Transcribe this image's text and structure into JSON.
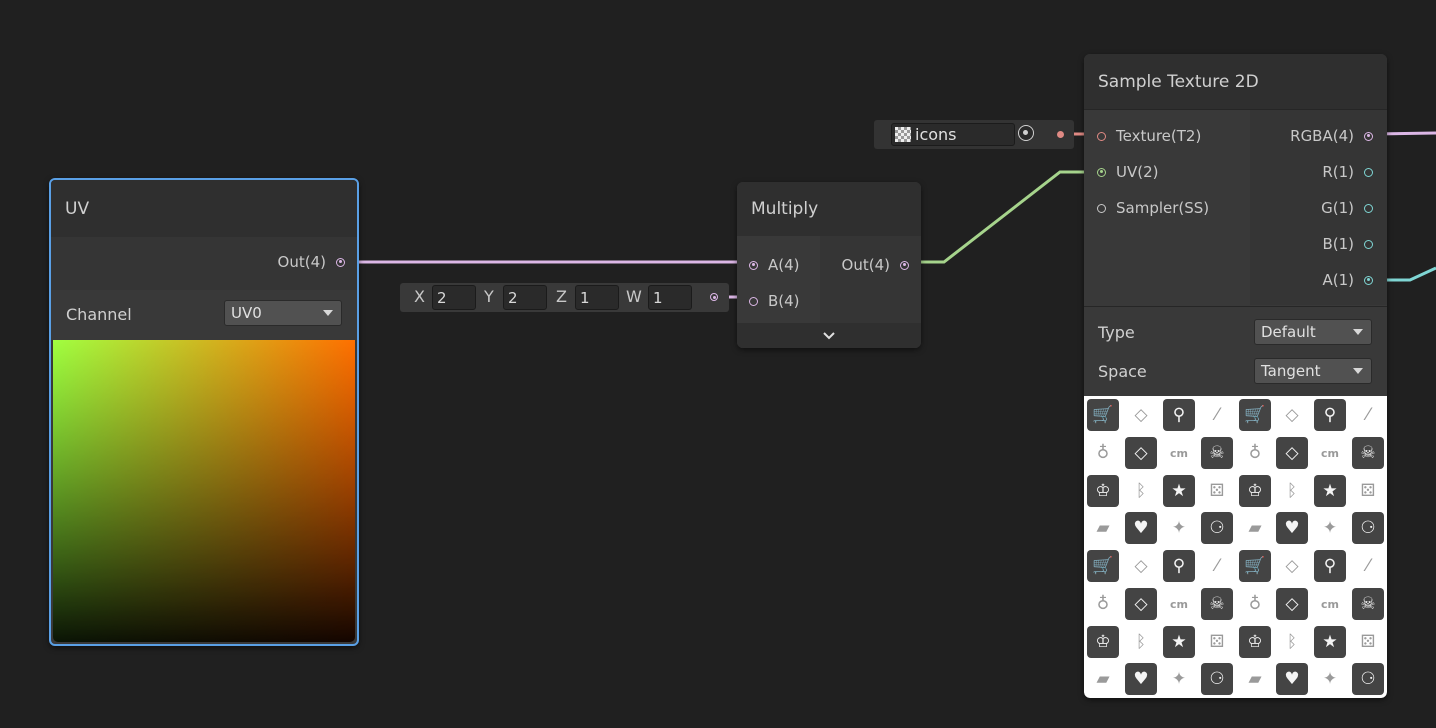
{
  "colors": {
    "background": "#202020",
    "selection": "#5aa0e6",
    "vector4": "#dcb7e6",
    "vector2": "#a6d48c",
    "texture": "#e08a84",
    "vector1": "#7fd6d4"
  },
  "uv_node": {
    "title": "UV",
    "out_label": "Out(4)",
    "channel_label": "Channel",
    "channel_value": "UV0"
  },
  "vector_input": {
    "fields": [
      {
        "axis": "X",
        "value": "2"
      },
      {
        "axis": "Y",
        "value": "2"
      },
      {
        "axis": "Z",
        "value": "1"
      },
      {
        "axis": "W",
        "value": "1"
      }
    ]
  },
  "multiply_node": {
    "title": "Multiply",
    "input_a": "A(4)",
    "input_b": "B(4)",
    "output": "Out(4)"
  },
  "texture_property": {
    "name": "icons"
  },
  "sample_node": {
    "title": "Sample Texture 2D",
    "inputs": [
      "Texture(T2)",
      "UV(2)",
      "Sampler(SS)"
    ],
    "outputs": [
      "RGBA(4)",
      "R(1)",
      "G(1)",
      "B(1)",
      "A(1)"
    ],
    "type_label": "Type",
    "type_value": "Default",
    "space_label": "Space",
    "space_value": "Tangent"
  },
  "icon_grid": [
    [
      "cart",
      "gem",
      "racket",
      "dropper",
      "cart",
      "gem",
      "racket",
      "dropper"
    ],
    [
      "piggy",
      "gem",
      "cm",
      "skull",
      "piggy",
      "gem",
      "cm",
      "skull"
    ],
    [
      "trophy",
      "bluetooth",
      "star",
      "dice",
      "trophy",
      "bluetooth",
      "star",
      "dice"
    ],
    [
      "briefcase",
      "heart",
      "sparkle",
      "bike",
      "briefcase",
      "heart",
      "sparkle",
      "bike"
    ],
    [
      "cart",
      "gem",
      "racket",
      "dropper",
      "cart",
      "gem",
      "racket",
      "dropper"
    ],
    [
      "piggy",
      "gem",
      "cm",
      "skull",
      "piggy",
      "gem",
      "cm",
      "skull"
    ],
    [
      "trophy",
      "bluetooth",
      "star",
      "dice",
      "trophy",
      "bluetooth",
      "star",
      "dice"
    ],
    [
      "briefcase",
      "heart",
      "sparkle",
      "bike",
      "briefcase",
      "heart",
      "sparkle",
      "bike"
    ]
  ],
  "icon_text": {
    "cart": "🛒",
    "gem": "◇",
    "racket": "⚲",
    "dropper": "⁄",
    "piggy": "♁",
    "cm": "cm",
    "skull": "☠",
    "trophy": "♔",
    "bluetooth": "ᛒ",
    "star": "★",
    "dice": "⚄",
    "briefcase": "▰",
    "heart": "♥",
    "sparkle": "✦",
    "bike": "⚆"
  }
}
